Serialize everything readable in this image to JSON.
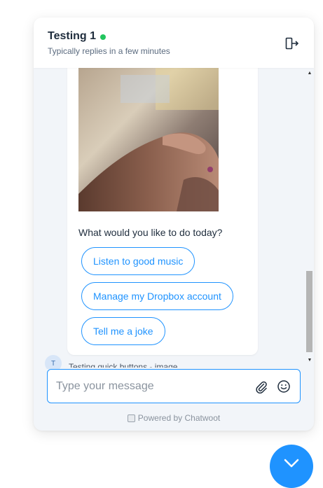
{
  "header": {
    "title": "Testing 1",
    "subtitle": "Typically replies in a few minutes",
    "status_color": "#22c55e",
    "logout_icon": "logout-icon"
  },
  "message": {
    "image_alt": "hand-photo",
    "question": "What would you like to do today?",
    "options": [
      {
        "label": "Listen to good music"
      },
      {
        "label": "Manage my Dropbox account"
      },
      {
        "label": "Tell me a joke"
      }
    ],
    "avatar_initial": "T",
    "next_message_preview": "Testing quick buttons - image"
  },
  "composer": {
    "placeholder": "Type your message",
    "value": "",
    "attach_icon": "paperclip-icon",
    "emoji_icon": "emoji-icon"
  },
  "footer": {
    "powered_by": "Powered by Chatwoot"
  },
  "colors": {
    "accent": "#1f93ff",
    "background": "#f2f5f9"
  }
}
